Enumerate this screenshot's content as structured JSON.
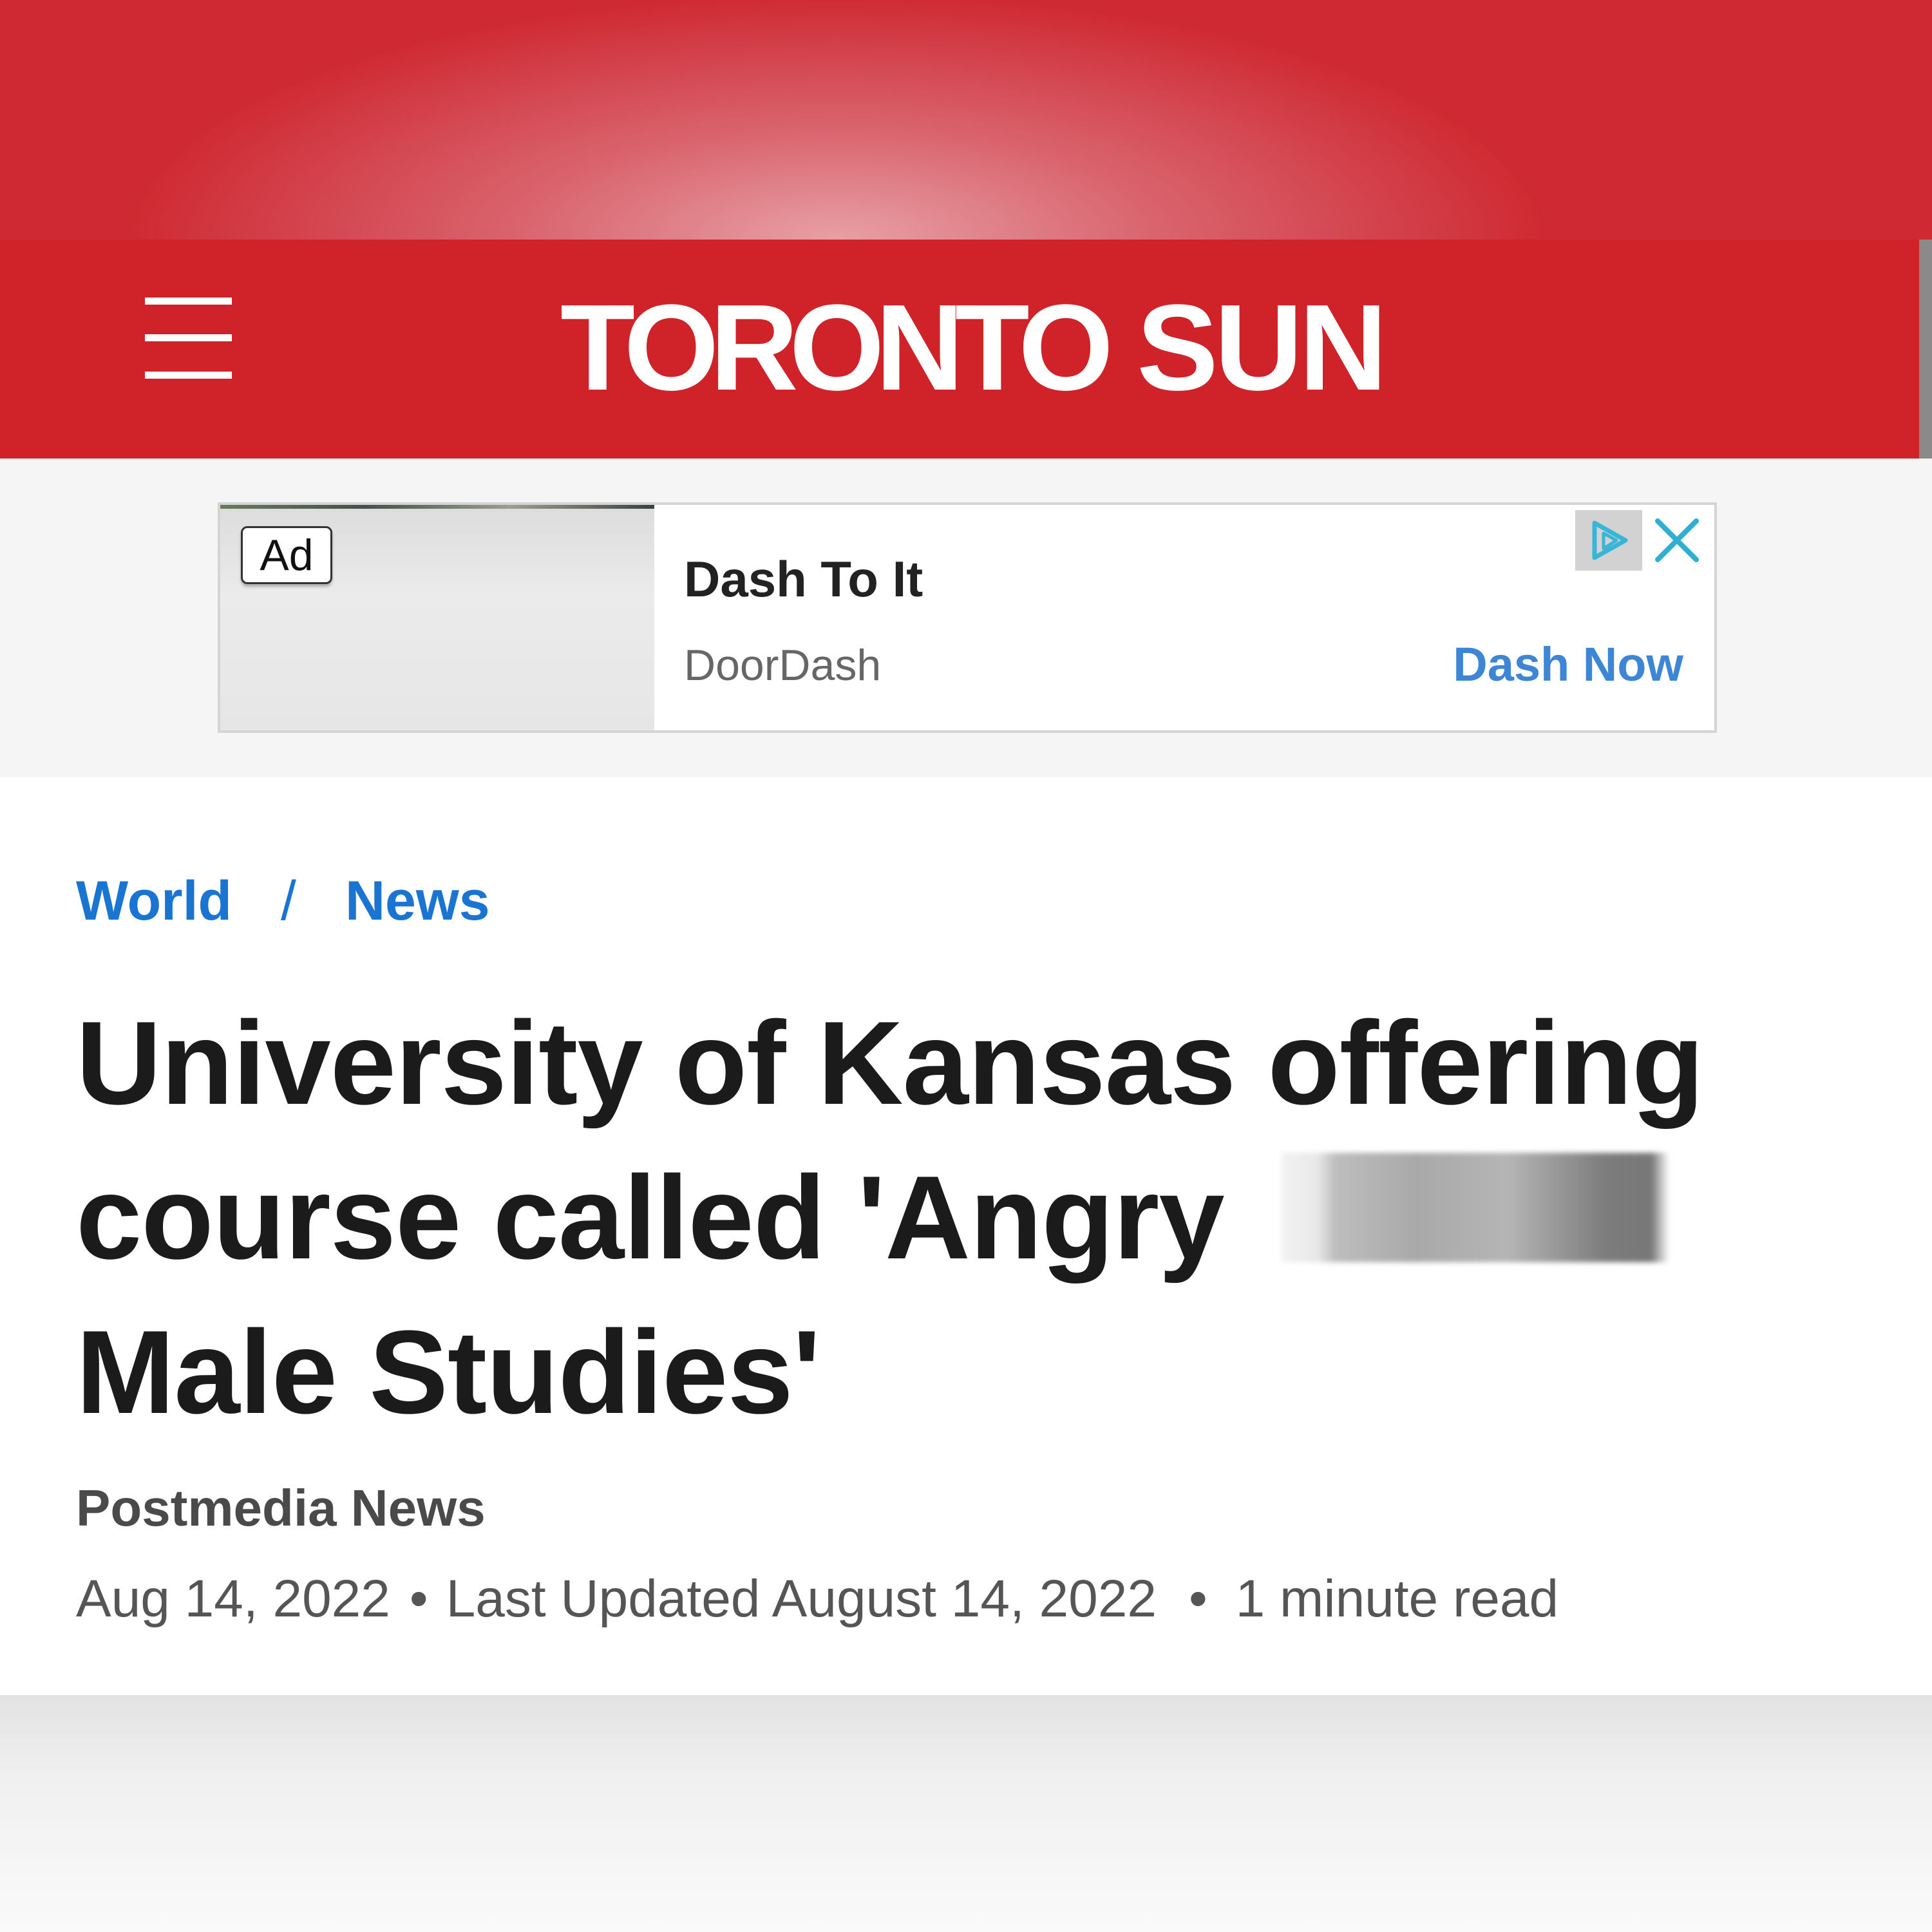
{
  "header": {
    "logo_part1": "TORONTO",
    "logo_part2": "SUN",
    "menu_icon": "hamburger-menu-icon",
    "brand_color": "#cf2229"
  },
  "ad": {
    "badge": "Ad",
    "headline": "Dash To It",
    "sponsor": "DoorDash",
    "cta": "Dash Now",
    "choices_icon": "adchoices-icon",
    "close_icon": "close-icon",
    "cta_color": "#3d86d6"
  },
  "breadcrumb": {
    "section": "World",
    "separator": "/",
    "subsection": "News"
  },
  "article": {
    "headline_line1": "University of Kansas offering",
    "headline_line2": "course called 'Angry",
    "headline_line3": "Male Studies'",
    "byline": "Postmedia News",
    "date": "Aug 14, 2022",
    "updated": "Last Updated August 14, 2022",
    "read_time": "1 minute read",
    "link_color": "#1a75d2"
  }
}
